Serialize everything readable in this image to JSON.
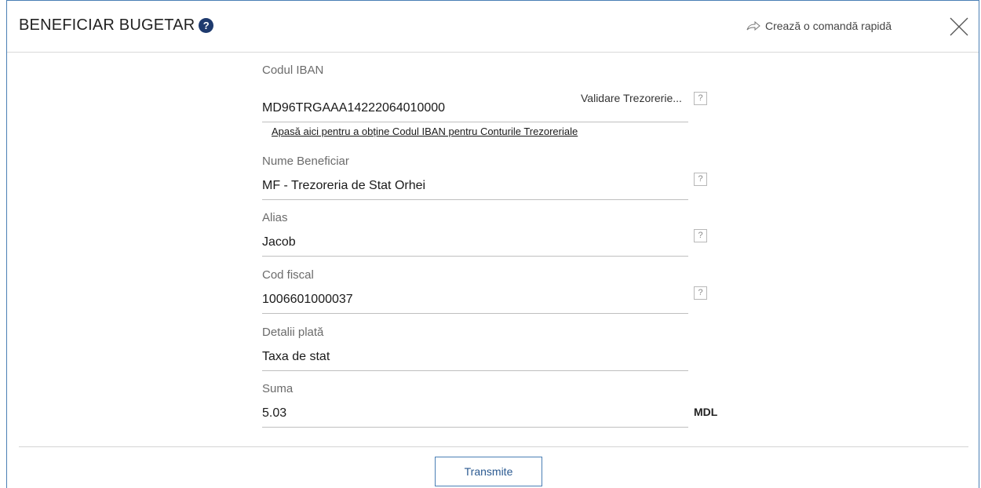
{
  "header": {
    "title": "BENEFICIAR BUGETAR",
    "help_icon": "?",
    "shortcut_label": "Crează o comandă rapidă"
  },
  "fields": {
    "iban": {
      "label": "Codul IBAN",
      "value": "MD96TRGAAA14222064010000",
      "validate_label": "Validare Trezorerie...",
      "help": "?",
      "link": "Apasă aici pentru a obține Codul IBAN pentru Conturile Trezoreriale"
    },
    "beneficiary": {
      "label": "Nume Beneficiar",
      "value": "MF - Trezoreria de Stat Orhei",
      "help": "?"
    },
    "alias": {
      "label": "Alias",
      "value": "Jacob",
      "help": "?"
    },
    "fiscal": {
      "label": "Cod fiscal",
      "value": "1006601000037",
      "help": "?"
    },
    "details": {
      "label": "Detalii plată",
      "value": "Taxa de stat"
    },
    "amount": {
      "label": "Suma",
      "value": "5.03",
      "currency": "MDL"
    }
  },
  "footer": {
    "submit_label": "Transmite"
  },
  "colors": {
    "accent": "#4a7fb5",
    "help_circle": "#1e3a6e"
  },
  "icons": {
    "shortcut": "share-arrow-icon",
    "close": "close-icon",
    "help": "help-circle-icon"
  }
}
